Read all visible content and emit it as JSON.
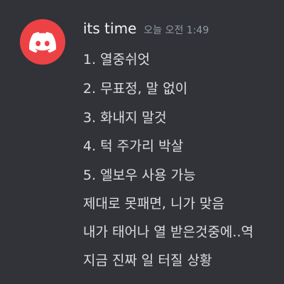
{
  "message": {
    "username": "its time",
    "timestamp": "오늘 오전 1:49",
    "avatar_icon": "discord-logo-icon",
    "avatar_color": "#ed4245",
    "lines": [
      "1. 열중쉬엇",
      "2. 무표정, 말 없이",
      "3. 화내지 말것",
      "4. 턱 주가리 박살",
      "5. 엘보우 사용 가능",
      "제대로 못패면, 니가 맞음",
      "내가 태어나 열 받은것중에..역",
      "지금 진짜 일 터질 상황"
    ]
  }
}
